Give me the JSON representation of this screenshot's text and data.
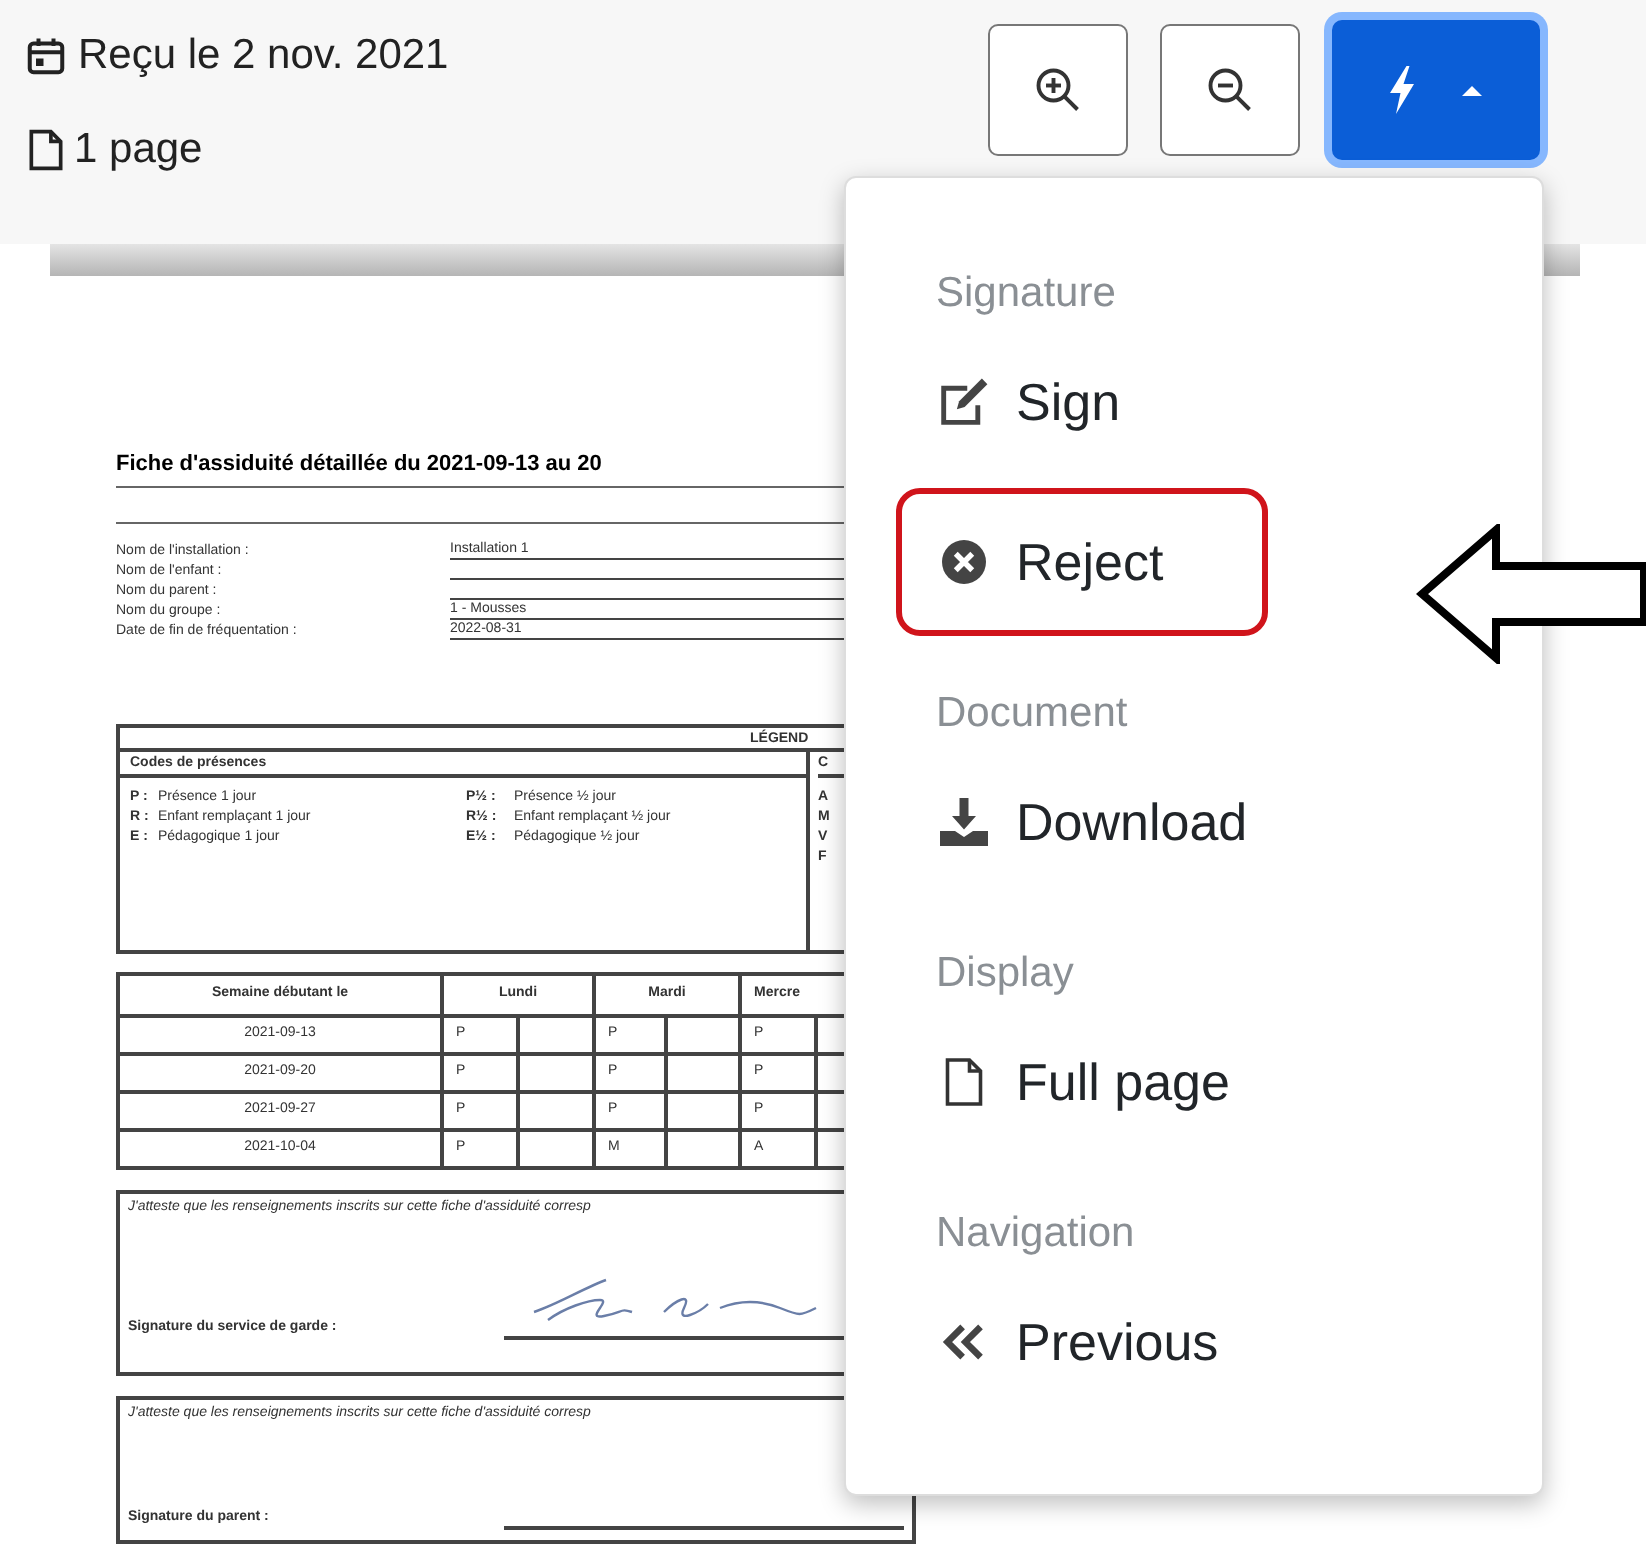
{
  "header": {
    "received": "Reçu le 2 nov. 2021",
    "pages": "1 page"
  },
  "toolbar": [
    {
      "kind": "zoom-in"
    },
    {
      "kind": "zoom-out"
    },
    {
      "kind": "actions",
      "expanded": true
    }
  ],
  "menu": [
    {
      "header": "Signature",
      "items": [
        {
          "label": "Sign",
          "kind": "pencil-square",
          "circled": false
        },
        {
          "label": "Reject",
          "kind": "x-circle",
          "circled": true
        }
      ]
    },
    {
      "header": "Document",
      "items": [
        {
          "label": "Download",
          "kind": "download",
          "circled": false
        }
      ]
    },
    {
      "header": "Display",
      "items": [
        {
          "label": "Full page",
          "kind": "file",
          "circled": false
        }
      ]
    },
    {
      "header": "Navigation",
      "items": [
        {
          "label": "Previous",
          "kind": "chevrons-left",
          "circled": false
        }
      ]
    }
  ],
  "annotations": [
    {
      "kind": "arrow"
    }
  ],
  "document": {
    "title": "Fiche d'assiduité détaillée du 2021-09-13 au 20",
    "fields": [
      {
        "label": "Nom de l'installation :",
        "value": "Installation 1"
      },
      {
        "label": "Nom de l'enfant :"
      },
      {
        "label": "Nom du parent :"
      },
      {
        "label": "Nom du groupe :",
        "value": "1 - Mousses"
      },
      {
        "label": "Date de fin de fréquentation :",
        "value": "2022-08-31"
      }
    ],
    "legend": {
      "title": "LÉGEND",
      "codes_title": "Codes de présences",
      "column_2_title": "C",
      "codes": [
        {
          "code": "P :",
          "text": "Présence 1 jour"
        },
        {
          "code": "P½ :",
          "text": "Présence ½ jour"
        },
        {
          "code": "R :",
          "text": "Enfant remplaçant 1 jour"
        },
        {
          "code": "R½ :",
          "text": "Enfant remplaçant ½ jour"
        },
        {
          "code": "E :",
          "text": "Pédagogique 1 jour"
        },
        {
          "code": "E½ :",
          "text": "Pédagogique ½ jour"
        }
      ],
      "column_2_codes": [
        "A",
        "M",
        "V",
        "F"
      ]
    },
    "attendance": {
      "columns": [
        {
          "label": "Semaine débutant le"
        },
        {
          "label": "Lundi",
          "colspan": 2
        },
        {
          "label": "Mardi",
          "colspan": 2
        },
        {
          "label": "Mercre",
          "colspan": 2
        }
      ],
      "rows": [
        {
          "cells": [
            "2021-09-13",
            "P",
            "",
            "P",
            "",
            "P",
            ""
          ]
        },
        {
          "cells": [
            "2021-09-20",
            "P",
            "",
            "P",
            "",
            "P",
            ""
          ]
        },
        {
          "cells": [
            "2021-09-27",
            "P",
            "",
            "P",
            "",
            "P",
            ""
          ]
        },
        {
          "cells": [
            "2021-10-04",
            "P",
            "",
            "M",
            "",
            "A",
            ""
          ]
        }
      ]
    },
    "attestations": [
      {
        "text": "J'atteste que les renseignements inscrits sur cette fiche d'assiduité corresp",
        "signature_label": "Signature du service de garde :",
        "signed": true
      },
      {
        "text": "J'atteste que les renseignements inscrits sur cette fiche d'assiduité corresp",
        "signature_label": "Signature du parent :",
        "signed": false
      }
    ]
  }
}
